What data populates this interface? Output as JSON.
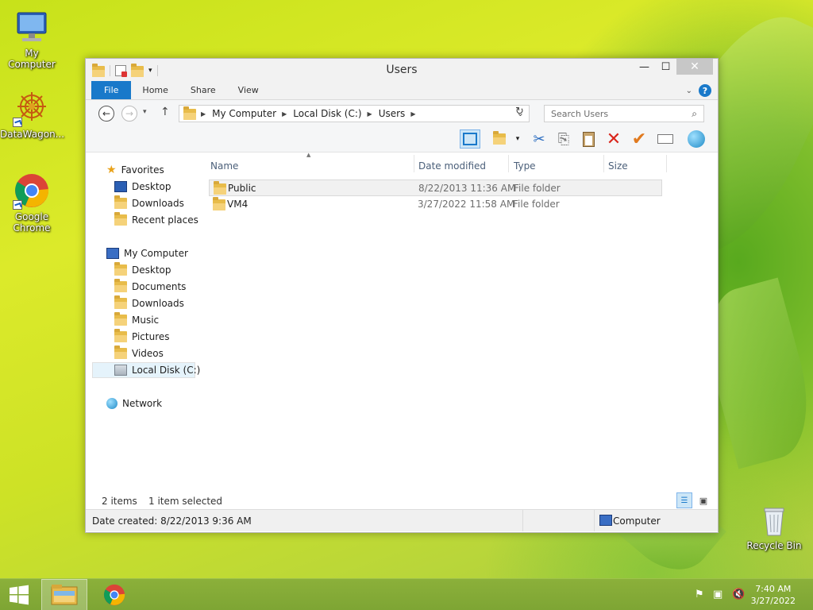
{
  "desktop": {
    "icons": [
      {
        "label": "My Computer"
      },
      {
        "label": "DataWagon..."
      },
      {
        "label": "Google Chrome"
      },
      {
        "label": "Recycle Bin"
      }
    ]
  },
  "window": {
    "title": "Users",
    "buttons": {
      "minimize": "—",
      "maximize": "☐",
      "close": "✕"
    },
    "ribbon_tabs": [
      {
        "label": "File"
      },
      {
        "label": "Home"
      },
      {
        "label": "Share"
      },
      {
        "label": "View"
      }
    ],
    "help": "?",
    "address": {
      "crumbs": [
        "My Computer",
        "Local Disk (C:)",
        "Users"
      ]
    },
    "search": {
      "placeholder": "Search Users"
    },
    "nav": {
      "favorites": {
        "label": "Favorites",
        "items": [
          {
            "label": "Desktop"
          },
          {
            "label": "Downloads"
          },
          {
            "label": "Recent places"
          }
        ]
      },
      "computer": {
        "label": "My Computer",
        "items": [
          {
            "label": "Desktop"
          },
          {
            "label": "Documents"
          },
          {
            "label": "Downloads"
          },
          {
            "label": "Music"
          },
          {
            "label": "Pictures"
          },
          {
            "label": "Videos"
          },
          {
            "label": "Local Disk (C:)"
          }
        ]
      },
      "network": {
        "label": "Network"
      }
    },
    "columns": [
      "Name",
      "Date modified",
      "Type",
      "Size"
    ],
    "files": [
      {
        "name": "Public",
        "modified": "8/22/2013 11:36 AM",
        "type": "File folder",
        "size": "",
        "selected": true
      },
      {
        "name": "VM4",
        "modified": "3/27/2022 11:58 AM",
        "type": "File folder",
        "size": "",
        "selected": false
      }
    ],
    "status": {
      "count": "2 items",
      "selection": "1 item selected",
      "details": "Date created: 8/22/2013 9:36 AM",
      "zone": "Computer"
    }
  },
  "taskbar": {
    "time": "7:40 AM",
    "date": "3/27/2022"
  },
  "colors": {
    "accent": "#1979ca",
    "folder": "#e8bc4a",
    "taskbar": "#84aa37"
  }
}
